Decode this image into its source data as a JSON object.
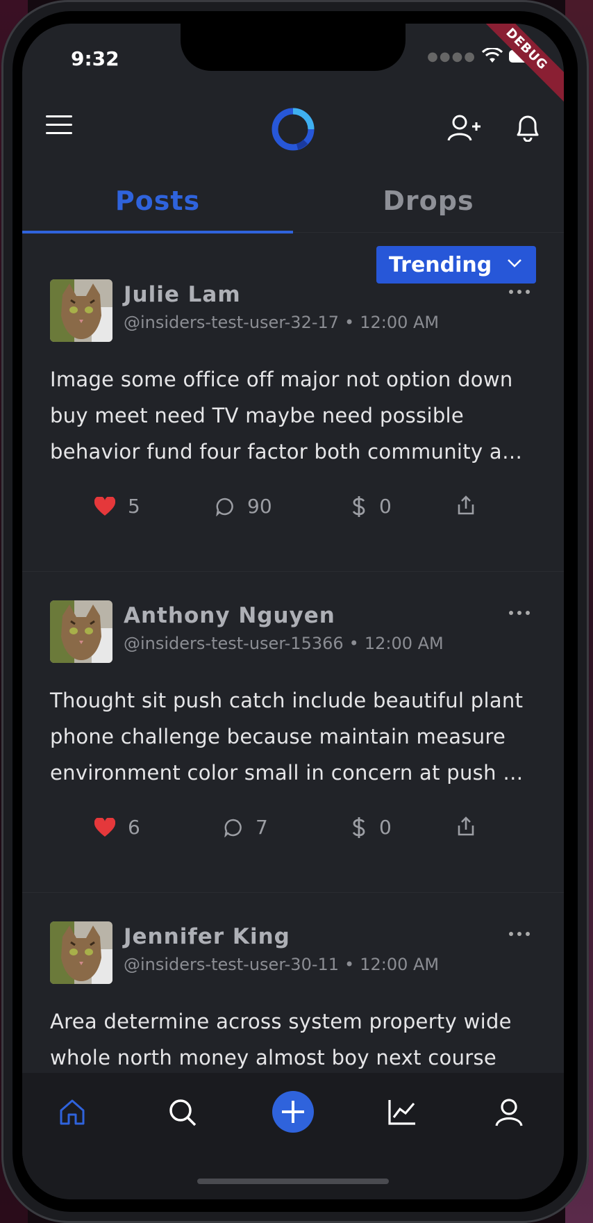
{
  "status_bar": {
    "time": "9:32",
    "debug_label": "DEBUG"
  },
  "header": {
    "menu_icon": "menu-icon",
    "logo": "app-logo-ring",
    "add_user_icon": "add-user-icon",
    "bell_icon": "bell-icon"
  },
  "tabs": [
    {
      "label": "Posts",
      "active": true
    },
    {
      "label": "Drops",
      "active": false
    }
  ],
  "sort": {
    "label": "Trending"
  },
  "posts": [
    {
      "author": "Julie Lam",
      "handle": "@insiders-test-user-32-17",
      "time": "12:00 AM",
      "text": "Image some office off major not option down buy meet need TV maybe need possible behavior fund four factor both community a…",
      "likes": "5",
      "comments": "90",
      "tips": "0"
    },
    {
      "author": "Anthony Nguyen",
      "handle": "@insiders-test-user-15366",
      "time": "12:00 AM",
      "text": "Thought sit push catch include beautiful plant phone challenge because maintain measure environment color small in concern at push …",
      "likes": "6",
      "comments": "7",
      "tips": "0"
    },
    {
      "author": "Jennifer King",
      "handle": "@insiders-test-user-30-11",
      "time": "12:00 AM",
      "text": "Area determine across system property wide whole north money almost boy next course"
    }
  ],
  "bottom_nav": [
    "home-icon",
    "search-icon",
    "create-post-icon",
    "chart-icon",
    "profile-icon"
  ],
  "colors": {
    "accent": "#2f63dc",
    "background": "#212328",
    "like": "#e5383b"
  }
}
